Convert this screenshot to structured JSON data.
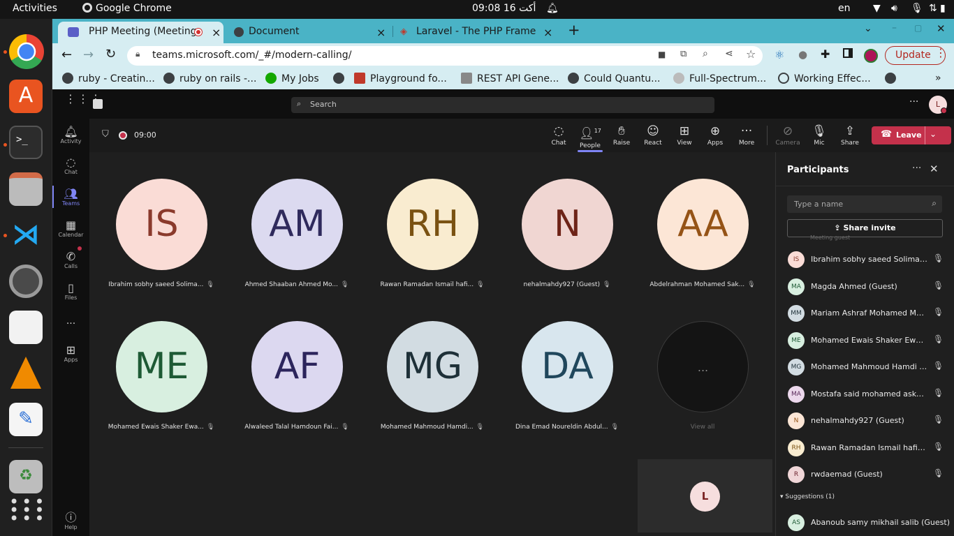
{
  "topbar": {
    "activities": "Activities",
    "app": "Google Chrome",
    "clock_time": "09:08",
    "clock_date": "16 أكت",
    "lang": "en"
  },
  "tabs": [
    {
      "label": "PHP Meeting (Meeting"
    },
    {
      "label": "Document"
    },
    {
      "label": "Laravel - The PHP Framew"
    }
  ],
  "toolbar": {
    "url": "teams.microsoft.com/_#/modern-calling/",
    "update_label": "Update"
  },
  "bookmarks": [
    {
      "label": "ruby - Creatin..."
    },
    {
      "label": "ruby on rails -..."
    },
    {
      "label": "My Jobs"
    },
    {
      "label": "Playground fo..."
    },
    {
      "label": "REST API Gene..."
    },
    {
      "label": "Could Quantu..."
    },
    {
      "label": "Full-Spectrum..."
    },
    {
      "label": "Working Effec..."
    }
  ],
  "teams_header": {
    "search_placeholder": "Search",
    "profile_initial": "L"
  },
  "rail": [
    {
      "label": "Activity"
    },
    {
      "label": "Chat"
    },
    {
      "label": "Teams"
    },
    {
      "label": "Calendar"
    },
    {
      "label": "Calls"
    },
    {
      "label": "Files"
    },
    {
      "label": "..."
    },
    {
      "label": "Apps"
    },
    {
      "label": "Help"
    }
  ],
  "meeting": {
    "timer": "09:00",
    "people_count": "17",
    "controls": [
      {
        "label": "Chat"
      },
      {
        "label": "People"
      },
      {
        "label": "Raise"
      },
      {
        "label": "React"
      },
      {
        "label": "View"
      },
      {
        "label": "Apps"
      },
      {
        "label": "More"
      },
      {
        "label": "Camera"
      },
      {
        "label": "Mic"
      },
      {
        "label": "Share"
      }
    ],
    "leave_label": "Leave"
  },
  "grid": [
    {
      "initials": "IS",
      "name": "Ibrahim sobhy saeed Solima...",
      "bg": "#fadcd6",
      "fg": "#8a3a2c"
    },
    {
      "initials": "AM",
      "name": "Ahmed Shaaban Ahmed Mo...",
      "bg": "#dcdaf0",
      "fg": "#2f2a5c"
    },
    {
      "initials": "RH",
      "name": "Rawan Ramadan Ismail hafi...",
      "bg": "#f9ecd0",
      "fg": "#7a5212"
    },
    {
      "initials": "N",
      "name": "nehalmahdy927 (Guest)",
      "bg": "#f0d6d2",
      "fg": "#6e2418"
    },
    {
      "initials": "AA",
      "name": "Abdelrahman Mohamed Sak...",
      "bg": "#fce6d6",
      "fg": "#955316"
    },
    {
      "initials": "ME",
      "name": "Mohamed Ewais Shaker Ewa...",
      "bg": "#d8efe0",
      "fg": "#1e5a35"
    },
    {
      "initials": "AF",
      "name": "Alwaleed Talal Hamdoun Fai...",
      "bg": "#dcd8f0",
      "fg": "#2c255c"
    },
    {
      "initials": "MG",
      "name": "Mohamed Mahmoud Hamdi...",
      "bg": "#d2dce2",
      "fg": "#1e3038"
    },
    {
      "initials": "DA",
      "name": "Dina Emad Noureldin Abdul...",
      "bg": "#d8e6ee",
      "fg": "#20475c"
    }
  ],
  "view_all": {
    "label": "View all",
    "glyph": "..."
  },
  "self_view": {
    "initial": "L"
  },
  "participants": {
    "title": "Participants",
    "search_placeholder": "Type a name",
    "share_invite": "Share invite",
    "partial_header": "Meeting guest",
    "list": [
      {
        "initials": "IS",
        "name": "Ibrahim sobhy saeed Soliman (...",
        "bg": "#fadcd6",
        "fg": "#8a3a2c"
      },
      {
        "initials": "MA",
        "name": "Magda Ahmed (Guest)",
        "bg": "#d8efe0",
        "fg": "#1e5a35"
      },
      {
        "initials": "MM",
        "name": "Mariam Ashraf Mohamed Mah...",
        "bg": "#d2dce2",
        "fg": "#1e3038"
      },
      {
        "initials": "ME",
        "name": "Mohamed Ewais Shaker Ewais (...",
        "bg": "#d8efe0",
        "fg": "#1e5a35"
      },
      {
        "initials": "MG",
        "name": "Mohamed Mahmoud Hamdi Go...",
        "bg": "#d2dce2",
        "fg": "#1e3038"
      },
      {
        "initials": "MA",
        "name": "Mostafa said mohamed askar (...",
        "bg": "#ecd8ec",
        "fg": "#5a2a5a"
      },
      {
        "initials": "N",
        "name": "nehalmahdy927 (Guest)",
        "bg": "#fce6d6",
        "fg": "#955316"
      },
      {
        "initials": "RH",
        "name": "Rawan Ramadan Ismail hafiz (G...",
        "bg": "#f9ecd0",
        "fg": "#7a5212"
      },
      {
        "initials": "R",
        "name": "rwdaemad (Guest)",
        "bg": "#f0d6d8",
        "fg": "#6e2430"
      }
    ],
    "suggestions_label": "Suggestions (1)",
    "suggestion": {
      "initials": "AS",
      "name": "Abanoub samy mikhail salib (Guest)",
      "bg": "#d8efe0",
      "fg": "#1e5a35"
    }
  },
  "colors": {
    "teams_accent": "#7f85f5",
    "leave_red": "#c4314b",
    "tabstrip": "#4ab3c6",
    "toolbar": "#d6edf2"
  }
}
